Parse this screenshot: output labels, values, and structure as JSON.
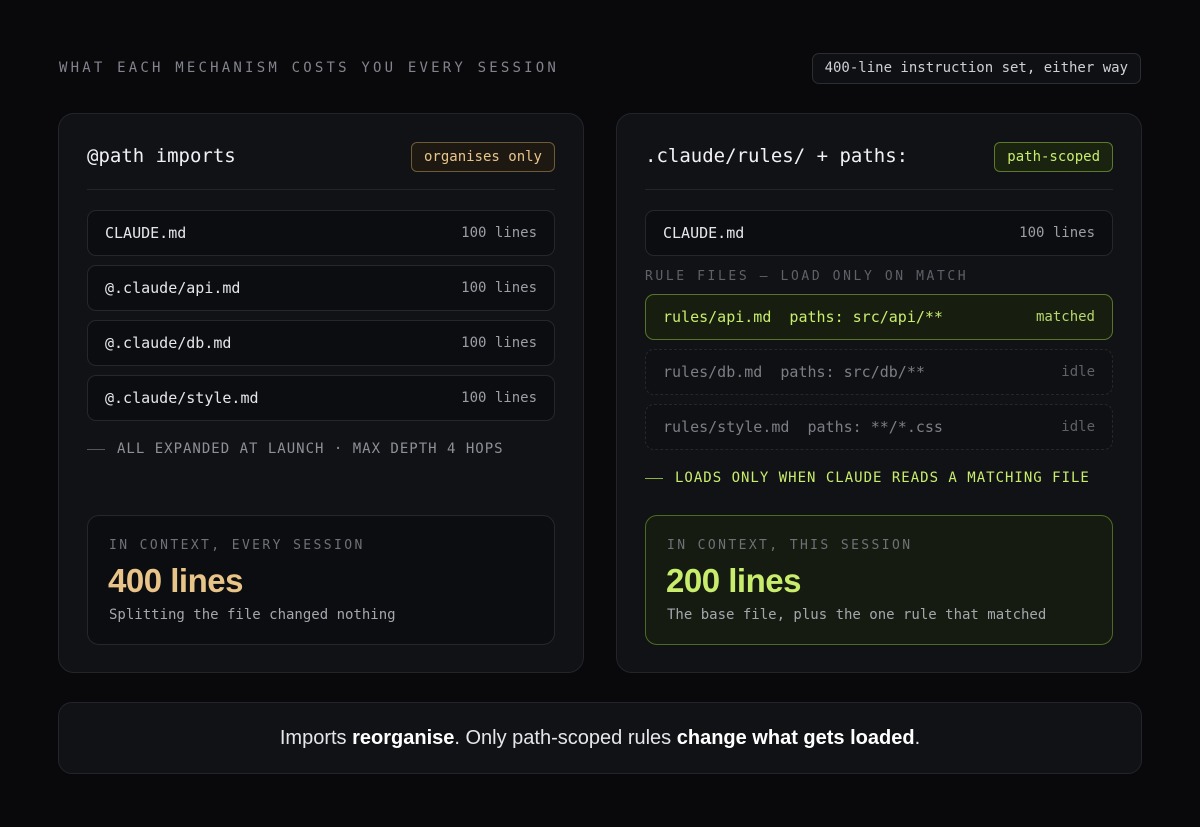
{
  "header": {
    "title": "WHAT EACH MECHANISM COSTS YOU EVERY SESSION",
    "pill": "400-line instruction set, either way"
  },
  "left": {
    "title": "@path imports",
    "badge": "organises only",
    "rows": [
      {
        "name": "CLAUDE.md",
        "count": "100 lines"
      },
      {
        "name": "@.claude/api.md",
        "count": "100 lines"
      },
      {
        "name": "@.claude/db.md",
        "count": "100 lines"
      },
      {
        "name": "@.claude/style.md",
        "count": "100 lines"
      }
    ],
    "note": "ALL EXPANDED AT LAUNCH · MAX DEPTH 4 HOPS",
    "summary": {
      "label": "IN CONTEXT, EVERY SESSION",
      "value": "400 lines",
      "desc": "Splitting the file changed nothing"
    }
  },
  "right": {
    "title": ".claude/rules/ + paths:",
    "badge": "path-scoped",
    "base_row": {
      "name": "CLAUDE.md",
      "count": "100 lines"
    },
    "subhead": "RULE FILES — LOAD ONLY ON MATCH",
    "rules": [
      {
        "name": "rules/api.md  paths: src/api/**",
        "status": "matched"
      },
      {
        "name": "rules/db.md  paths: src/db/**",
        "status": "idle"
      },
      {
        "name": "rules/style.md  paths: **/*.css",
        "status": "idle"
      }
    ],
    "note": "LOADS ONLY WHEN CLAUDE READS A MATCHING FILE",
    "summary": {
      "label": "IN CONTEXT, THIS SESSION",
      "value": "200 lines",
      "desc": "The base file, plus the one rule that matched"
    }
  },
  "footer": {
    "t1": "Imports ",
    "b1": "reorganise",
    "t2": ". Only path-scoped rules ",
    "b2": "change what gets loaded",
    "t3": "."
  },
  "colors": {
    "amber": "#e8c489",
    "green": "#c8ec6c",
    "background": "#09090b"
  }
}
